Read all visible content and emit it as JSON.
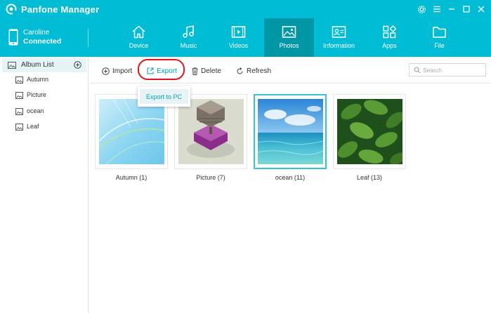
{
  "app": {
    "title": "Panfone Manager"
  },
  "device": {
    "name": "Caroline",
    "status": "Connected"
  },
  "nav": {
    "tabs": [
      {
        "label": "Device",
        "icon": "home-icon"
      },
      {
        "label": "Music",
        "icon": "music-note-icon"
      },
      {
        "label": "Videos",
        "icon": "video-icon"
      },
      {
        "label": "Photos",
        "icon": "image-icon",
        "active": true
      },
      {
        "label": "Information",
        "icon": "contact-card-icon"
      },
      {
        "label": "Apps",
        "icon": "apps-grid-icon"
      },
      {
        "label": "File",
        "icon": "folder-icon"
      }
    ]
  },
  "sidebar": {
    "header": "Album List",
    "items": [
      {
        "label": "Autumn"
      },
      {
        "label": "Picture"
      },
      {
        "label": "ocean"
      },
      {
        "label": "Leaf"
      }
    ]
  },
  "toolbar": {
    "import_label": "Import",
    "export_label": "Export",
    "delete_label": "Delete",
    "refresh_label": "Refresh"
  },
  "export_menu": {
    "items": [
      {
        "label": "Export to PC"
      }
    ]
  },
  "search": {
    "placeholder": "Search",
    "value": ""
  },
  "albums": [
    {
      "caption": "Autumn (1)"
    },
    {
      "caption": "Picture (7)"
    },
    {
      "caption": "ocean (11)",
      "selected": true
    },
    {
      "caption": "Leaf (13)"
    }
  ],
  "colors": {
    "accent": "#00bcd4",
    "active_tab": "#0097a7",
    "highlight": "#e0141a"
  }
}
